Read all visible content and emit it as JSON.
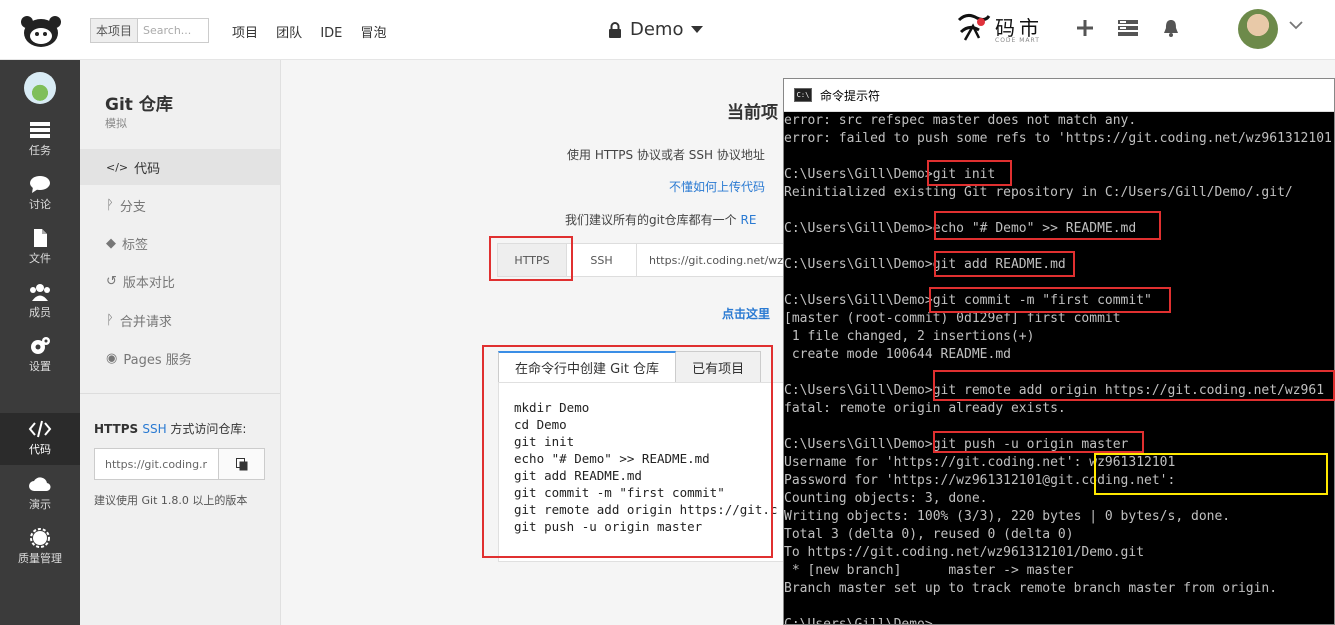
{
  "topbar": {
    "scope_tag": "本项目",
    "search_placeholder": "Search...",
    "nav": [
      "项目",
      "团队",
      "IDE",
      "冒泡"
    ],
    "project_name": "Demo",
    "brand_text": "码市",
    "brand_sub": "CODE MART"
  },
  "leftnav": {
    "items": [
      {
        "label": "任务",
        "icon": "task-icon"
      },
      {
        "label": "讨论",
        "icon": "chat-icon"
      },
      {
        "label": "文件",
        "icon": "file-icon"
      },
      {
        "label": "成员",
        "icon": "members-icon"
      },
      {
        "label": "设置",
        "icon": "settings-icon"
      },
      {
        "label": "代码",
        "icon": "code-icon",
        "active": true
      },
      {
        "label": "演示",
        "icon": "cloud-icon"
      },
      {
        "label": "质量管理",
        "icon": "quality-icon"
      }
    ]
  },
  "sidebar": {
    "title": "Git 仓库",
    "subtitle": "模拟",
    "items": [
      {
        "label": "代码",
        "icon": "</>",
        "active": true
      },
      {
        "label": "分支",
        "icon": "ᚹ"
      },
      {
        "label": "标签",
        "icon": "◆"
      },
      {
        "label": "版本对比",
        "icon": "↺"
      },
      {
        "label": "合并请求",
        "icon": "ᚹ"
      },
      {
        "label": "Pages 服务",
        "icon": "◉"
      }
    ],
    "access_https": "HTTPS",
    "access_ssh": "SSH",
    "access_rest": " 方式访问仓库:",
    "url_value": "https://git.coding.r",
    "tip": "建议使用 Git 1.8.0 以上的版本"
  },
  "main": {
    "title": "当前项",
    "desc": "使用 HTTPS 协议或者 SSH 协议地址",
    "link_upload": "不懂如何上传代码",
    "recommend": "我们建议所有的git仓库都有一个 ",
    "recommend_link": "RE",
    "tab_https": "HTTPS",
    "tab_ssh": "SSH",
    "url_value": "https://git.coding.net/wz",
    "click_here": "点击这里",
    "code_tabs": [
      "在命令行中创建 Git 仓库",
      "已有项目"
    ],
    "code_lines": [
      "mkdir Demo",
      "cd Demo",
      "git init",
      "echo \"# Demo\" >> README.md",
      "git add README.md",
      "git commit -m \"first commit\"",
      "git remote add origin https://git.c",
      "git push -u origin master"
    ]
  },
  "cmd": {
    "title": "命令提示符",
    "icon_text": "C:\\",
    "lines": [
      "error: src refspec master does not match any.",
      "error: failed to push some refs to 'https://git.coding.net/wz961312101",
      "",
      "C:\\Users\\Gill\\Demo>git init",
      "Reinitialized existing Git repository in C:/Users/Gill/Demo/.git/",
      "",
      "C:\\Users\\Gill\\Demo>echo \"# Demo\" >> README.md",
      "",
      "C:\\Users\\Gill\\Demo>git add README.md",
      "",
      "C:\\Users\\Gill\\Demo>git commit -m \"first commit\"",
      "[master (root-commit) 0d129ef] first commit",
      " 1 file changed, 2 insertions(+)",
      " create mode 100644 README.md",
      "",
      "C:\\Users\\Gill\\Demo>git remote add origin https://git.coding.net/wz961",
      "fatal: remote origin already exists.",
      "",
      "C:\\Users\\Gill\\Demo>git push -u origin master",
      "Username for 'https://git.coding.net': wz961312101",
      "Password for 'https://wz961312101@git.coding.net':",
      "Counting objects: 3, done.",
      "Writing objects: 100% (3/3), 220 bytes | 0 bytes/s, done.",
      "Total 3 (delta 0), reused 0 (delta 0)",
      "To https://git.coding.net/wz961312101/Demo.git",
      " * [new branch]      master -> master",
      "Branch master set up to track remote branch master from origin.",
      "",
      "C:\\Users\\Gill\\Demo>"
    ]
  }
}
